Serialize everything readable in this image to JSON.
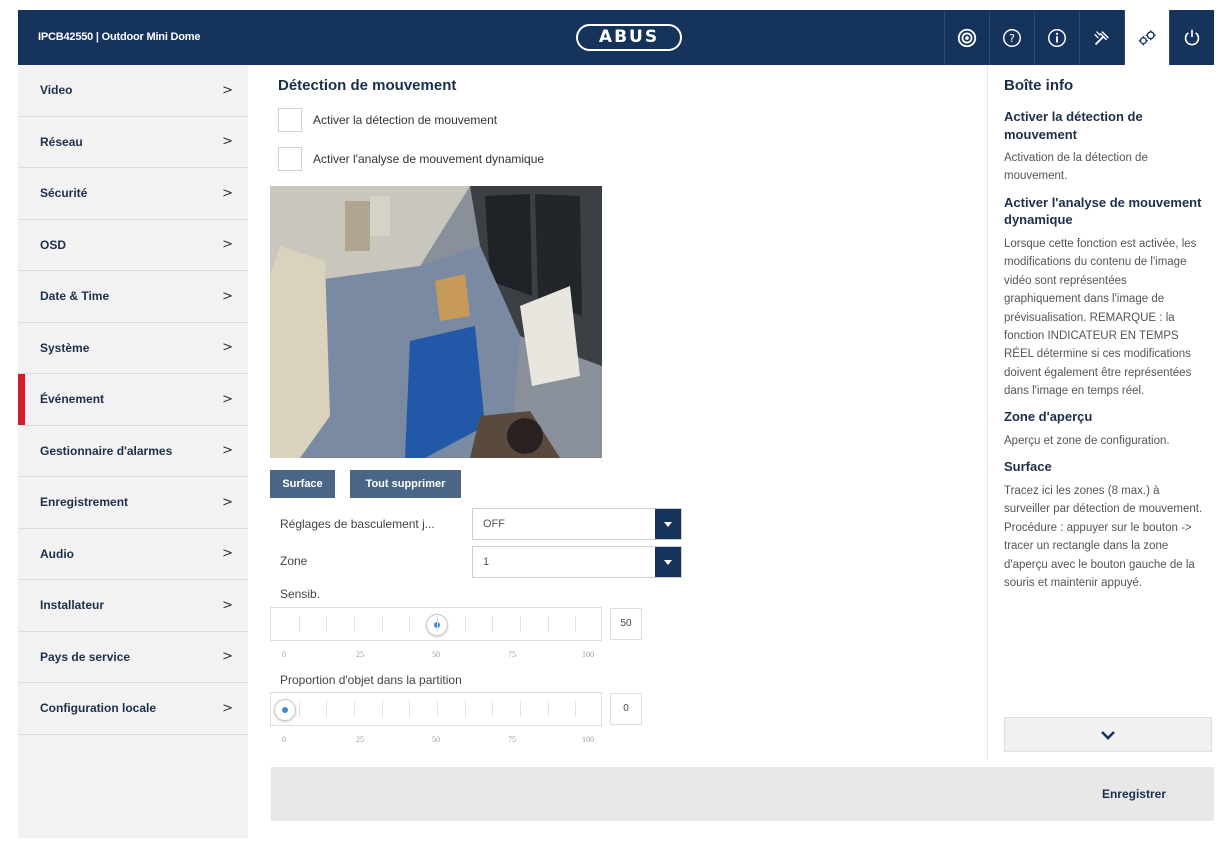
{
  "header": {
    "title": "IPCB42550  |  Outdoor Mini Dome",
    "logo": "ABUS",
    "icons": [
      "camera-icon",
      "help-icon",
      "info-icon",
      "tools-icon",
      "settings-icon",
      "power-icon"
    ],
    "active_icon": "settings-icon",
    "colors": {
      "bar": "#16335c",
      "accent_red": "#d31d2a"
    }
  },
  "sidebar": {
    "items": [
      {
        "label": "Video"
      },
      {
        "label": "Réseau"
      },
      {
        "label": "Sécurité"
      },
      {
        "label": "OSD"
      },
      {
        "label": "Date & Time"
      },
      {
        "label": "Système"
      },
      {
        "label": "Événement"
      },
      {
        "label": "Gestionnaire d'alarmes"
      },
      {
        "label": "Enregistrement"
      },
      {
        "label": "Audio"
      },
      {
        "label": "Installateur"
      },
      {
        "label": "Pays de service"
      },
      {
        "label": "Configuration locale"
      }
    ],
    "chevron": ">",
    "active_index": 6
  },
  "main": {
    "title": "Détection de mouvement",
    "checkbox_motion": "Activer la détection de mouvement",
    "checkbox_dynamic": "Activer l'analyse de mouvement dynamique",
    "btn_surface": "Surface",
    "btn_delete_all": "Tout supprimer",
    "switch_label": "Réglages de basculement j...",
    "switch_value": "OFF",
    "zone_label": "Zone",
    "zone_value": "1",
    "sensitivity_label": "Sensib.",
    "sensitivity_value": 50,
    "sensitivity_display": "50",
    "proportion_label": "Proportion d'objet dans la partition",
    "proportion_value": 0,
    "proportion_display": "0",
    "scale": [
      "0",
      "25",
      "50",
      "75",
      "100"
    ],
    "save": "Enregistrer"
  },
  "info": {
    "title": "Boîte info",
    "s1_title": "Activer la détection de mouvement",
    "s1_text": "Activation de la détection de mouvement.",
    "s2_title": "Activer l'analyse de mouvement dynamique",
    "s2_text": "Lorsque cette fonction est activée, les modifications du contenu de l'image vidéo sont représentées graphiquement dans l'image de prévisualisation. REMARQUE : la fonction INDICATEUR EN TEMPS RÉEL détermine si ces modifications doivent également être représentées dans l'image en temps réel.",
    "s3_title": "Zone d'aperçu",
    "s3_text": "Aperçu et zone de configuration.",
    "s4_title": "Surface",
    "s4_text": "Tracez ici les zones (8 max.) à surveiller par détection de mouvement. Procédure : appuyer sur le bouton -> tracer un rectangle dans la zone d'aperçu avec le bouton gauche de la souris et maintenir appuyé."
  }
}
